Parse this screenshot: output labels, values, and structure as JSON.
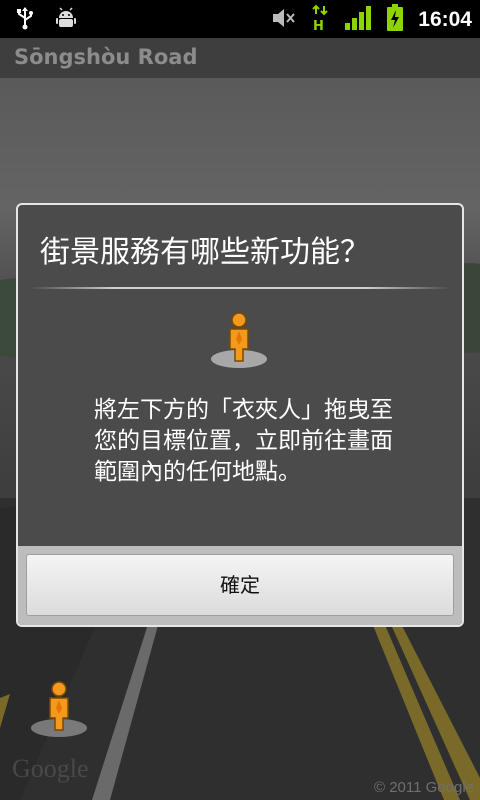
{
  "status_bar": {
    "time": "16:04",
    "icons": [
      "usb-icon",
      "android-debug-icon",
      "volume-muted-icon",
      "data-hspa-icon",
      "signal-icon",
      "battery-charging-icon"
    ]
  },
  "title_bar": {
    "title": "Sōngshòu Road"
  },
  "background": {
    "copyright": "© 2011 Google",
    "watermark": "Google"
  },
  "dialog": {
    "title": "街景服務有哪些新功能？",
    "body": "將左下方的「衣夾人」拖曳至您的目標位置，立即前往畫面範圍內的任何地點。",
    "ok_label": "確定"
  },
  "colors": {
    "pegman": "#f39a1e",
    "dialog_bg": "#4b4b4b",
    "status_green": "#8dd400"
  }
}
